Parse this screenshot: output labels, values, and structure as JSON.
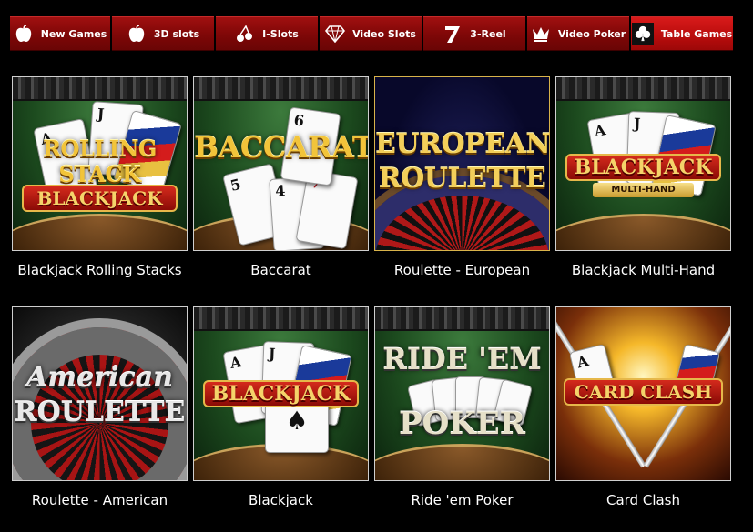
{
  "nav": {
    "tabs": [
      {
        "label": "New Games",
        "icon": "apple-icon",
        "active": false
      },
      {
        "label": "3D slots",
        "icon": "apple-icon",
        "active": false
      },
      {
        "label": "I-Slots",
        "icon": "cherries-icon",
        "active": false
      },
      {
        "label": "Video Slots",
        "icon": "diamond-icon",
        "active": false
      },
      {
        "label": "3-Reel",
        "icon": "seven-icon",
        "active": false
      },
      {
        "label": "Video Poker",
        "icon": "crown-icon",
        "active": false
      },
      {
        "label": "Table Games",
        "icon": "clover-icon",
        "active": true
      }
    ]
  },
  "games": [
    {
      "caption": "Blackjack Rolling Stacks",
      "art": {
        "line1": "ROLLING",
        "line2": "STACK",
        "banner": "BLACKJACK"
      }
    },
    {
      "caption": "Baccarat",
      "art": {
        "line1": "BACCARAT"
      }
    },
    {
      "caption": "Roulette - European",
      "art": {
        "line1": "EUROPEAN",
        "line2": "ROULETTE"
      }
    },
    {
      "caption": "Blackjack Multi-Hand",
      "art": {
        "banner": "BLACKJACK",
        "sub": "MULTI-HAND"
      }
    },
    {
      "caption": "Roulette - American",
      "art": {
        "line1": "American",
        "line2": "ROULETTE"
      }
    },
    {
      "caption": "Blackjack",
      "art": {
        "banner": "BLACKJACK"
      }
    },
    {
      "caption": "Ride 'em Poker",
      "art": {
        "line1": "RIDE 'EM",
        "line2": "POKER"
      }
    },
    {
      "caption": "Card Clash",
      "art": {
        "banner": "CARD CLASH"
      }
    }
  ],
  "colors": {
    "tab_bg": "#7e0707",
    "tab_active_bg": "#c20f0f",
    "page_bg": "#000000",
    "caption": "#ffffff"
  }
}
